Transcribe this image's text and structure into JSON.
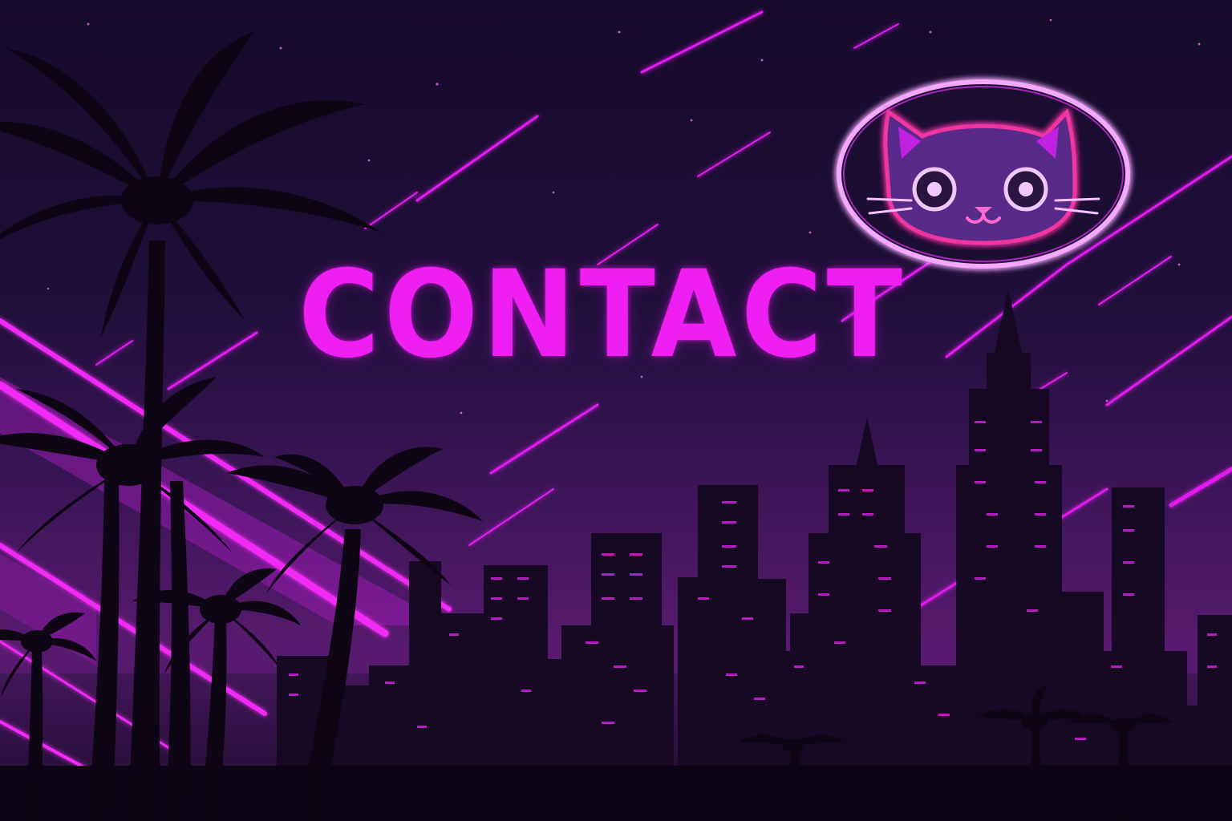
{
  "page": {
    "title": "CONTACT"
  },
  "logo": {
    "icon": "neon-cat-face-icon"
  },
  "colors": {
    "neon_magenta": "#ef1ff4",
    "neon_ring": "#f4a8ff",
    "sky_top": "#170b2c",
    "sky_mid": "#3a1556",
    "silhouette": "#12061c",
    "window_light": "#d420e0"
  }
}
